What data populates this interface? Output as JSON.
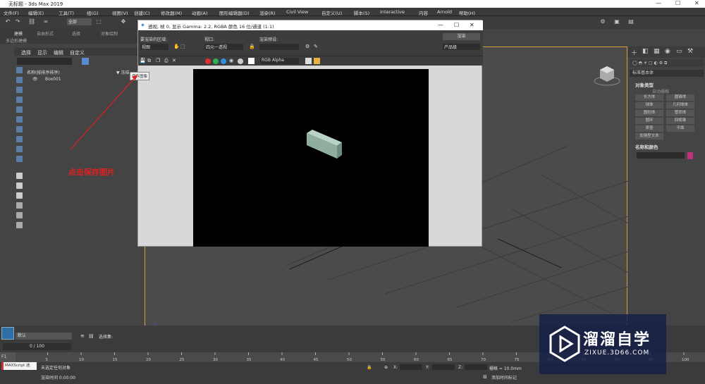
{
  "window": {
    "title": "无标题 - 3ds Max 2019"
  },
  "menu": [
    "文件(F)",
    "编辑(E)",
    "工具(T)",
    "组(G)",
    "视图(V)",
    "创建(C)",
    "修改器(M)",
    "动画(A)",
    "图形编辑器(D)",
    "渲染(R)",
    "Civil View",
    "自定义(U)",
    "脚本(S)",
    "Interactive",
    "内容",
    "Arnold",
    "帮助(H)"
  ],
  "toolbar": {
    "selection_filter": "全部",
    "workspace": "默认"
  },
  "ribbon": {
    "tabs": [
      "建模",
      "自由形式",
      "选择",
      "对象绘制"
    ],
    "sub": "多边形建模"
  },
  "scene": {
    "menu": [
      "选择",
      "显示",
      "编辑",
      "自定义"
    ],
    "col_name": "名称(按排序排序)",
    "col_sort": "▼ 冻结",
    "item": "Box001"
  },
  "dialog": {
    "title": "透视, 帧 0, 显示 Gamma: 2.2, RGBA 颜色 16 位/通道 (1:1)",
    "area_label": "要渲染的区域:",
    "area_value": "视图",
    "viewport_label": "视口:",
    "viewport_value": "四元一透视",
    "preset_label": "渲染预设:",
    "render_btn": "渲染",
    "product": "产品级",
    "channel": "RGB Alpha",
    "tooltip": "保存图像"
  },
  "annotation": "点击保存图片",
  "cmd": {
    "dropdown": "标准基本体",
    "rollout1": "对象类型",
    "auto_grid": "自动栅格",
    "buttons": [
      "长方体",
      "圆锥体",
      "球体",
      "几何球体",
      "圆柱体",
      "管状体",
      "圆环",
      "四棱锥",
      "茶壶",
      "平面",
      "加强型文本"
    ],
    "rollout2": "名称和颜色",
    "swatch": "#c0307a"
  },
  "bottom": {
    "layer": "默认",
    "selection_set": "选择集:",
    "frame": "0 / 100",
    "script": "MAXScript 迷",
    "status1": "未选定任何对象",
    "status2": "渲染时间 0:00:00",
    "grid": "栅格 = 10.0mm",
    "add_tag": "添加时间标记",
    "ticks": [
      "0",
      "5",
      "10",
      "15",
      "20",
      "25",
      "30",
      "35",
      "40",
      "45",
      "50",
      "55",
      "60",
      "65",
      "70",
      "75",
      "80",
      "85",
      "90",
      "95",
      "100"
    ]
  },
  "watermark": {
    "cn": "溜溜自学",
    "en": "ZIXUE.3D66.COM"
  }
}
